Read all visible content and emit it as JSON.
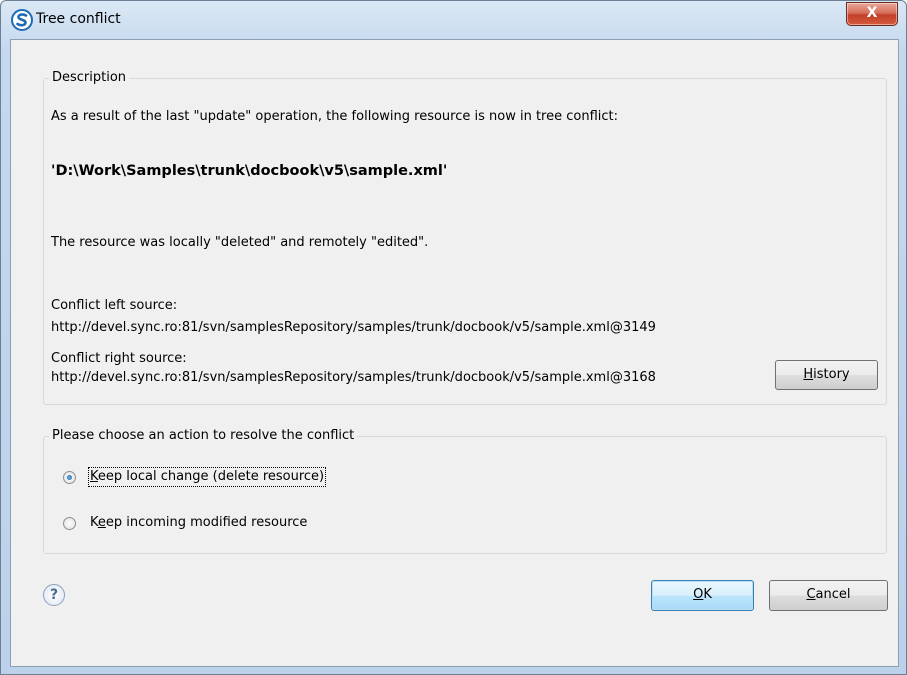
{
  "window": {
    "title": "Tree conflict",
    "close_symbol": "X"
  },
  "description": {
    "legend": "Description",
    "intro": "As a result of the last \"update\" operation, the following resource is now in tree conflict:",
    "path": "'D:\\Work\\Samples\\trunk\\docbook\\v5\\sample.xml'",
    "reason": "The resource was locally \"deleted\" and remotely \"edited\".",
    "left_label": "Conflict left source:",
    "left_url": "http://devel.sync.ro:81/svn/samplesRepository/samples/trunk/docbook/v5/sample.xml@3149",
    "right_label": "Conflict right source:",
    "right_url": "http://devel.sync.ro:81/svn/samplesRepository/samples/trunk/docbook/v5/sample.xml@3168",
    "history_button": {
      "mnemonic": "H",
      "rest": "istory"
    }
  },
  "action": {
    "legend": "Please choose an action to resolve the conflict",
    "options": [
      {
        "mnemonic": "K",
        "rest": "eep local change (delete resource)",
        "selected": true
      },
      {
        "prefix": "K",
        "mnemonic": "e",
        "rest": "ep incoming modified resource",
        "selected": false
      }
    ]
  },
  "footer": {
    "help_symbol": "?",
    "ok_button": {
      "mnemonic": "O",
      "rest": "K"
    },
    "cancel_button": {
      "mnemonic": "C",
      "rest": "ancel"
    }
  },
  "colors": {
    "accent": "#1c5ea8",
    "title_gradient_top": "#dbe8f5",
    "close_red": "#c2402a"
  },
  "icons": [
    "sync-logo-icon",
    "close-icon",
    "help-icon",
    "radio-selected-icon",
    "radio-unselected-icon"
  ]
}
